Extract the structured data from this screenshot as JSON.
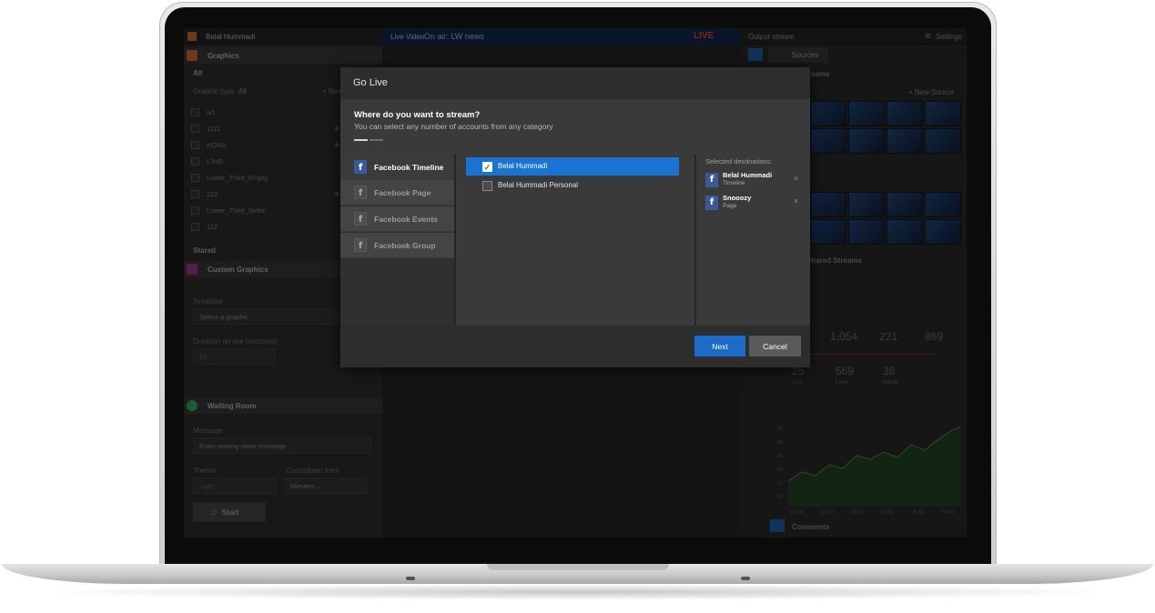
{
  "background_app": {
    "user_name": "Belal Hummadi",
    "settings_label": "Settings",
    "graphics_title": "Graphics",
    "all_label": "All",
    "graphic_type_label": "Graphic type",
    "graphic_type_value": "All",
    "new_label": "+ New",
    "graphic_items": [
      "w1",
      "1111",
      "KORA",
      "L3+R",
      "Lower_Third_Empty",
      "222",
      "Lower_Third_Selfie",
      "112"
    ],
    "stared_label": "Stared",
    "custom_graphics_label": "Custom Graphics",
    "template_label": "Template",
    "template_placeholder": "Select a graphic",
    "duration_label": "Duration on live (seconds)",
    "duration_value": "15",
    "waiting_room_label": "Waiting Room",
    "message_label": "Message",
    "message_placeholder": "Enter waiting room message...",
    "theme_label": "Theme",
    "theme_value": "Light",
    "countdown_label": "Countdown from",
    "countdown_placeholder": "Minutes...",
    "start_label": "Start",
    "live_video_tab": "Live Video",
    "live_video_channel": "On air: LW news",
    "live_badge": "LIVE",
    "output_stream_label": "Output stream",
    "sources_tab": "Sources",
    "streams_label": "Streams",
    "new_source_label": "+ New Source",
    "shared_streams_label": "Shared Streams",
    "stats_row1": [
      "1,054",
      "221",
      "869"
    ],
    "stats_row2": [
      "25",
      "569",
      "38"
    ],
    "stats_row2_labels": [
      "Sad",
      "Love",
      "Haha"
    ],
    "chart_y_ticks": [
      "5k",
      "4k",
      "3k",
      "2k",
      "1k",
      "0k"
    ],
    "chart_x_ticks": [
      "15:24",
      "15:28",
      "15:32",
      "15:36",
      "15:40",
      "15:44"
    ],
    "comments_label": "Comments"
  },
  "modal": {
    "title": "Go Live",
    "question": "Where do you want to stream?",
    "subtitle": "You can select any number of accounts from any category",
    "categories": [
      {
        "label": "Facebook Timeline",
        "active": true
      },
      {
        "label": "Facebook Page",
        "active": false
      },
      {
        "label": "Facebook Events",
        "active": false
      },
      {
        "label": "Facebook Group",
        "active": false
      }
    ],
    "accounts": [
      {
        "label": "Belal Hummadi",
        "checked": true
      },
      {
        "label": "Belal Hummadi Personal",
        "checked": false
      }
    ],
    "selected_destinations_title": "Selected destinations:",
    "destinations": [
      {
        "name": "Belal Hummadi",
        "type": "Timeline"
      },
      {
        "name": "Snooozy",
        "type": "Page"
      }
    ],
    "next_label": "Next",
    "cancel_label": "Cancel",
    "fb_glyph": "f",
    "check_glyph": "✓",
    "remove_glyph": "×"
  },
  "colors": {
    "accent_blue": "#1873d3",
    "facebook_blue": "#3b5998",
    "live_red": "#d9322a"
  }
}
